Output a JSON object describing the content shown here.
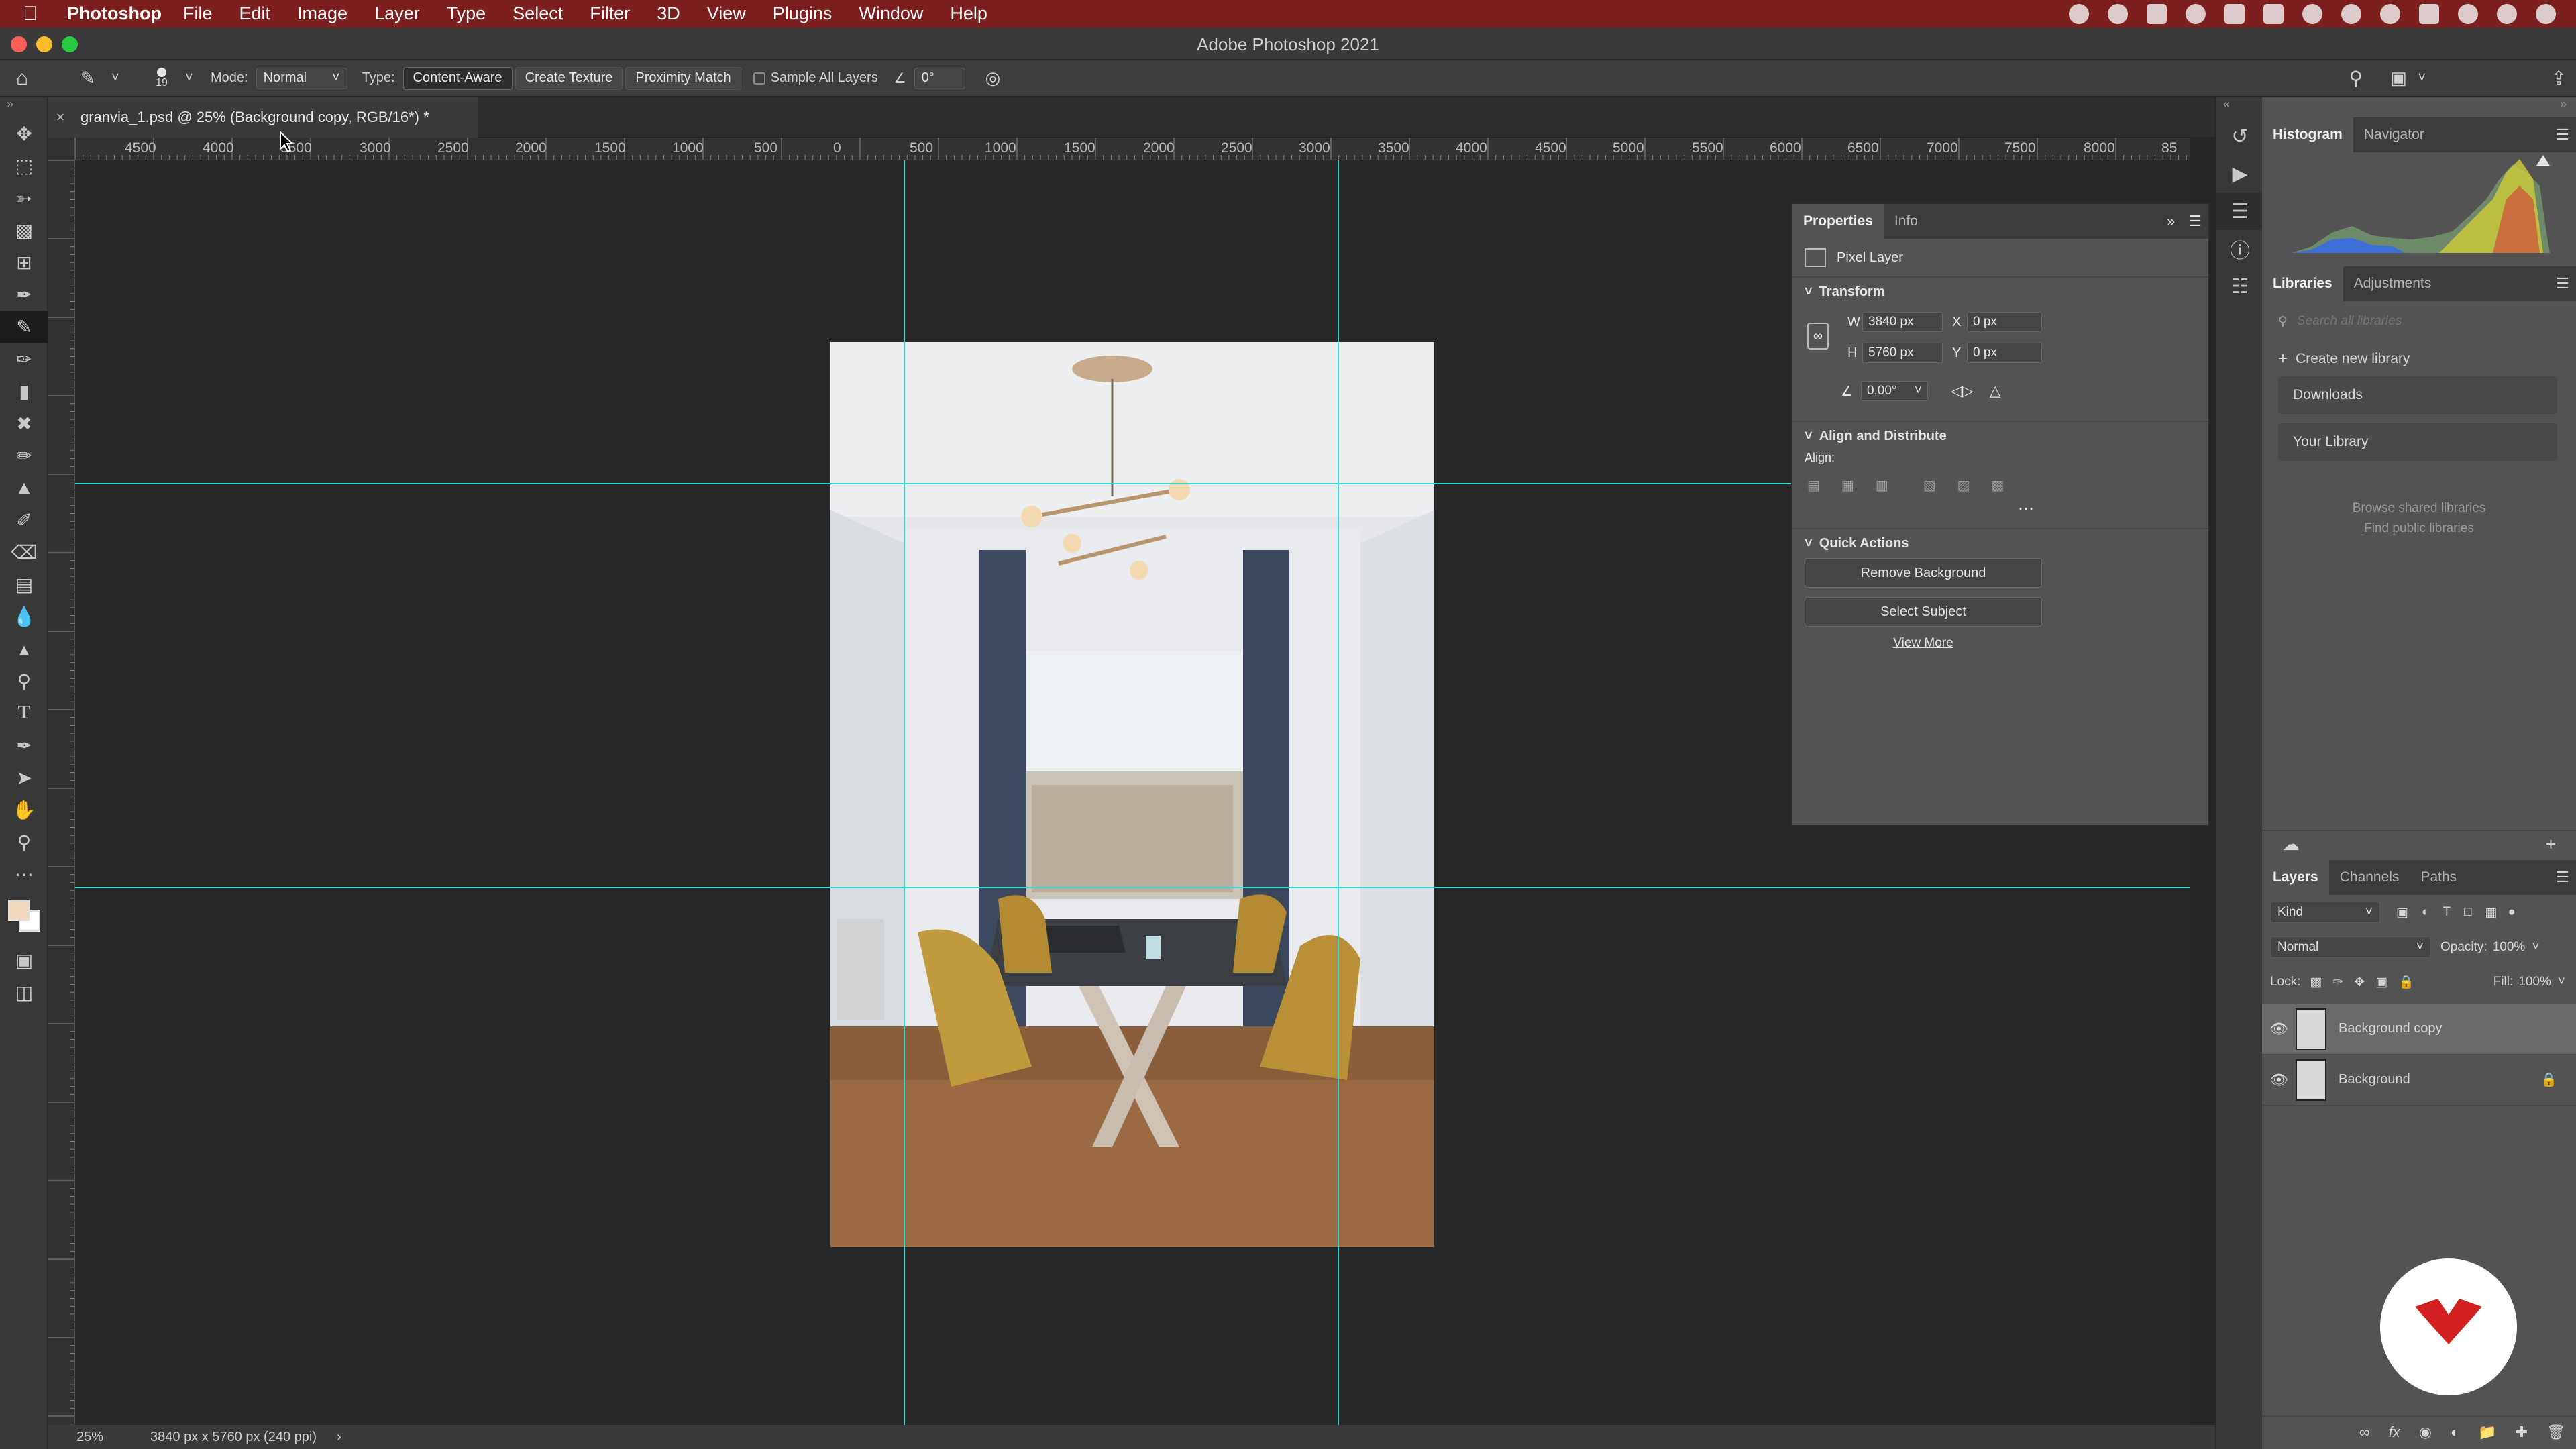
{
  "menubar": {
    "app_name": "Photoshop",
    "items": [
      "File",
      "Edit",
      "Image",
      "Layer",
      "Type",
      "Select",
      "Filter",
      "3D",
      "View",
      "Plugins",
      "Window",
      "Help"
    ]
  },
  "window": {
    "title": "Adobe Photoshop 2021"
  },
  "options_bar": {
    "brush_size": "19",
    "mode_label": "Mode:",
    "mode_value": "Normal",
    "type_label": "Type:",
    "type_buttons": [
      "Content-Aware",
      "Create Texture",
      "Proximity Match"
    ],
    "sample_all_layers": "Sample All Layers",
    "angle_value": "0°"
  },
  "document": {
    "tab_title": "granvia_1.psd @ 25% (Background copy, RGB/16*) *",
    "zoom": "25%",
    "doc_info": "3840 px x 5760 px (240 ppi)"
  },
  "ruler": {
    "h_labels": [
      "4500",
      "4000",
      "3500",
      "3000",
      "2500",
      "2000",
      "1500",
      "1000",
      "500",
      "0",
      "500",
      "1000",
      "1500",
      "2000",
      "2500",
      "3000",
      "3500",
      "4000",
      "4500",
      "5000",
      "5500",
      "6000",
      "6500",
      "7000",
      "7500",
      "8000",
      "85"
    ]
  },
  "properties": {
    "tabs": [
      "Properties",
      "Info"
    ],
    "layer_kind": "Pixel Layer",
    "transform_title": "Transform",
    "w_label": "W",
    "w_value": "3840 px",
    "h_label": "H",
    "h_value": "5760 px",
    "x_label": "X",
    "x_value": "0 px",
    "y_label": "Y",
    "y_value": "0 px",
    "angle_value": "0,00°",
    "align_title": "Align and Distribute",
    "align_label": "Align:",
    "quick_title": "Quick Actions",
    "remove_bg": "Remove Background",
    "select_subject": "Select Subject",
    "view_more": "View More"
  },
  "right_panels": {
    "histogram_tabs": [
      "Histogram",
      "Navigator"
    ],
    "library_tabs": [
      "Libraries",
      "Adjustments"
    ],
    "search_placeholder": "Search all libraries",
    "create_library": "Create new library",
    "libraries": [
      "Downloads",
      "Your Library"
    ],
    "browse_shared": "Browse shared libraries",
    "find_public": "Find public libraries"
  },
  "layers_panel": {
    "tabs": [
      "Layers",
      "Channels",
      "Paths"
    ],
    "filter_kind": "Kind",
    "blend_mode": "Normal",
    "opacity_label": "Opacity:",
    "opacity_value": "100%",
    "lock_label": "Lock:",
    "fill_label": "Fill:",
    "fill_value": "100%",
    "layers": [
      {
        "name": "Background copy",
        "selected": true
      },
      {
        "name": "Background",
        "selected": false
      }
    ]
  },
  "colors": {
    "menubar_bg": "#7e1f1f",
    "guide": "#3fd4d4",
    "foreground_swatch": "#f1d7bb",
    "logo_red": "#d31f1f"
  }
}
